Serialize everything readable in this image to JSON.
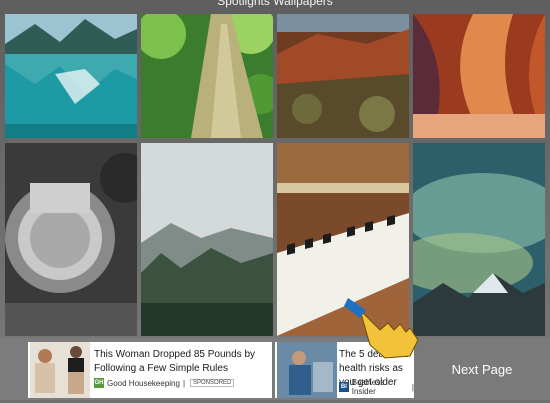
{
  "window": {
    "title": "Spotlights Wallpapers"
  },
  "wallpapers": [
    {
      "name": "lake-mountains",
      "subject": "Mountain lake reflection"
    },
    {
      "name": "tree-trunk",
      "subject": "Tall tree trunk looking up"
    },
    {
      "name": "canyon-rocks",
      "subject": "Red rock canyon"
    },
    {
      "name": "slot-canyon",
      "subject": "Orange slot canyon"
    },
    {
      "name": "camera-lens",
      "subject": "Vintage camera dial"
    },
    {
      "name": "misty-forest",
      "subject": "Misty pine forest"
    },
    {
      "name": "piano-keys",
      "subject": "Piano keys"
    },
    {
      "name": "aurora-mountains",
      "subject": "Aurora over mountains"
    }
  ],
  "ads": [
    {
      "headline": "This Woman Dropped 85 Pounds by Following a Few Simple Rules",
      "source": "Good Housekeeping",
      "source_logo": "GH",
      "badge": "SPONSORED"
    },
    {
      "headline": "The 5 deadliest health risks as you get older",
      "source": "Business Insider",
      "source_logo": "BI"
    }
  ],
  "next_page": {
    "label": "Next Page"
  },
  "colors": {
    "adbar": "#7c7c7c",
    "next_page_bg": "#7a7a7a"
  }
}
